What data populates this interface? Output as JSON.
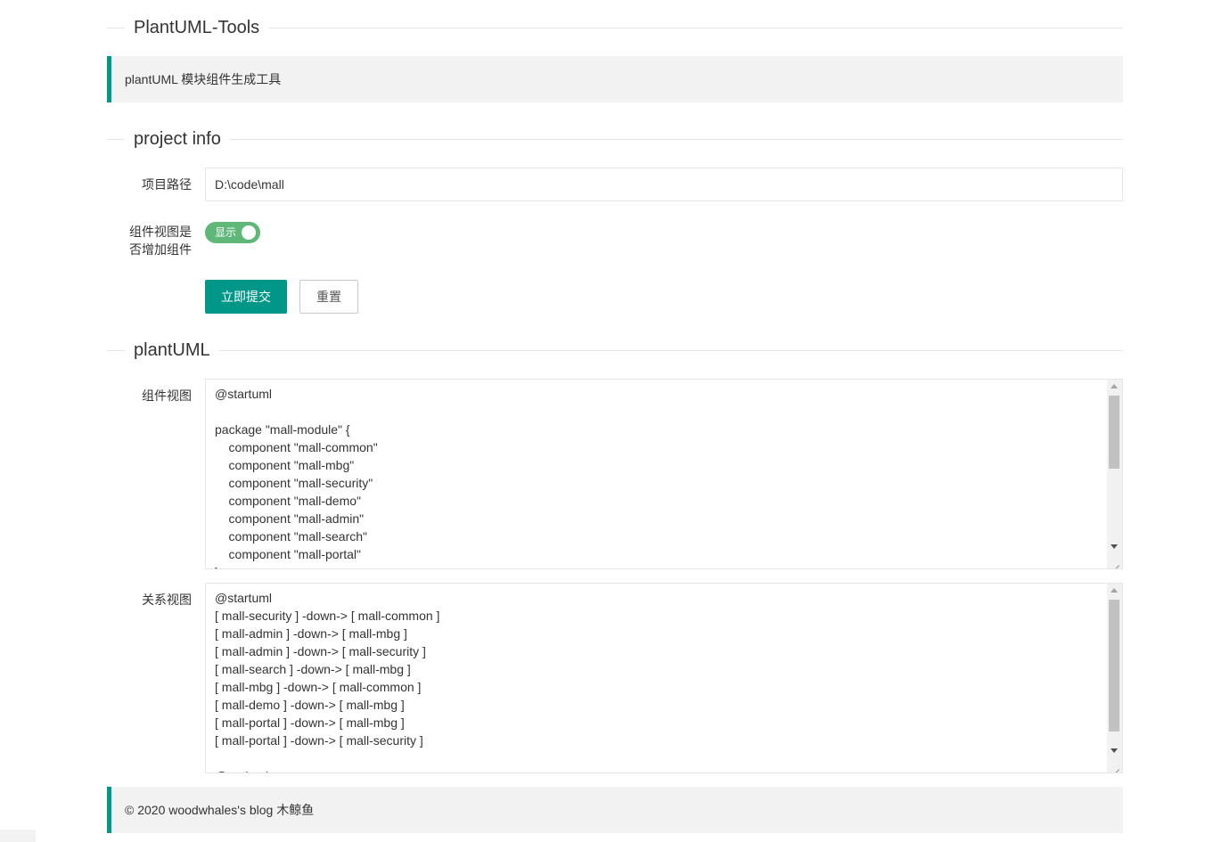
{
  "header": {
    "title": "PlantUML-Tools",
    "subtitle": "plantUML 模块组件生成工具"
  },
  "project_info": {
    "section_title": "project info",
    "path_label": "项目路径",
    "path_value": "D:\\code\\mall",
    "toggle_label_line1": "组件视图是",
    "toggle_label_line2": "否增加组件",
    "toggle_text": "显示",
    "toggle_on": true,
    "submit_label": "立即提交",
    "reset_label": "重置"
  },
  "plantuml": {
    "section_title": "plantUML",
    "component_label": "组件视图",
    "component_code": "@startuml\n\npackage \"mall-module\" {\n    component \"mall-common\"\n    component \"mall-mbg\"\n    component \"mall-security\"\n    component \"mall-demo\"\n    component \"mall-admin\"\n    component \"mall-search\"\n    component \"mall-portal\"\n}",
    "relation_label": "关系视图",
    "relation_code": "@startuml\n[ mall-security ] -down-> [ mall-common ]\n[ mall-admin ] -down-> [ mall-mbg ]\n[ mall-admin ] -down-> [ mall-security ]\n[ mall-search ] -down-> [ mall-mbg ]\n[ mall-mbg ] -down-> [ mall-common ]\n[ mall-demo ] -down-> [ mall-mbg ]\n[ mall-portal ] -down-> [ mall-mbg ]\n[ mall-portal ] -down-> [ mall-security ]\n\n@enduml"
  },
  "footer": {
    "text": "© 2020 woodwhales's blog 木鲸鱼"
  },
  "colors": {
    "accent": "#009688",
    "switch_on": "#5FB878",
    "quote_bg": "#f2f2f2"
  }
}
